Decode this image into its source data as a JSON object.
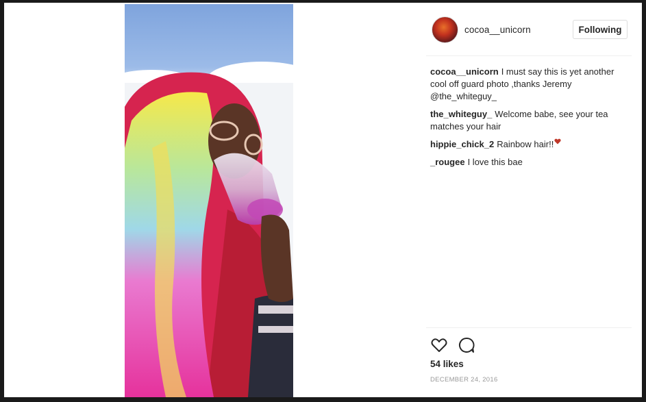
{
  "post": {
    "username": "cocoa__unicorn",
    "follow_label": "Following"
  },
  "comments": [
    {
      "author": "cocoa__unicorn",
      "text": "I must say this is yet another cool off guard photo ,thanks Jeremy @the_whiteguy_"
    },
    {
      "author": "the_whiteguy_",
      "text": "Welcome babe, see your tea matches your hair"
    },
    {
      "author": "hippie_chick_2",
      "text": "Rainbow hair!!"
    },
    {
      "author": "_rougee",
      "text": "I love this bae"
    }
  ],
  "actions": {
    "like_icon": "heart-outline-icon",
    "comment_icon": "speech-bubble-icon",
    "likes": "54 likes",
    "date": "DECEMBER 24, 2016"
  },
  "colors": {
    "text": "#262626",
    "muted": "#999999",
    "border": "#dbdbdb",
    "heart_emoji": "#c0392b"
  }
}
